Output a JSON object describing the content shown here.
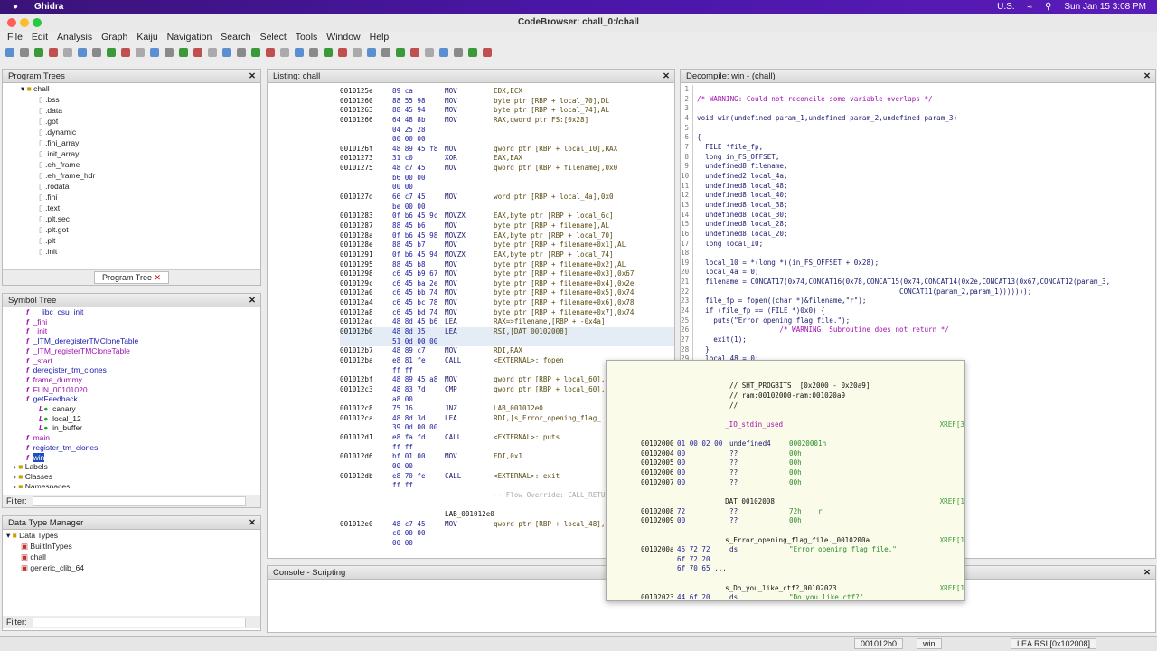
{
  "mac": {
    "app": "Ghidra",
    "keyboard": "U.S.",
    "clock": "Sun Jan 15  3:08 PM"
  },
  "window": {
    "title": "CodeBrowser: chall_0:/chall"
  },
  "menu": [
    "File",
    "Edit",
    "Analysis",
    "Graph",
    "Kaiju",
    "Navigation",
    "Search",
    "Select",
    "Tools",
    "Window",
    "Help"
  ],
  "program_trees": {
    "title": "Program Trees",
    "root": "chall",
    "items": [
      ".bss",
      ".data",
      ".got",
      ".dynamic",
      ".fini_array",
      ".init_array",
      ".eh_frame",
      ".eh_frame_hdr",
      ".rodata",
      ".fini",
      ".text",
      ".plt.sec",
      ".plt.got",
      ".plt",
      ".init"
    ],
    "tab": "Program Tree"
  },
  "symbol_tree": {
    "title": "Symbol Tree",
    "functions": [
      "__libc_csu_init",
      "_fini",
      "_init",
      "_ITM_deregisterTMCloneTable",
      "_ITM_registerTMCloneTable",
      "_start",
      "deregister_tm_clones",
      "frame_dummy",
      "FUN_00101020",
      "getFeedback"
    ],
    "locals": [
      "canary",
      "local_12",
      "in_buffer"
    ],
    "functions2": [
      "main",
      "register_tm_clones",
      "win"
    ],
    "folders": [
      "Labels",
      "Classes",
      "Namespaces"
    ],
    "filter_label": "Filter:"
  },
  "dtm": {
    "title": "Data Type Manager",
    "root": "Data Types",
    "items": [
      "BuiltInTypes",
      "chall",
      "generic_clib_64"
    ],
    "filter_label": "Filter:"
  },
  "listing": {
    "title": "Listing:  chall",
    "rows": [
      [
        "0010125e",
        "89 ca",
        "MOV",
        "EDX,ECX"
      ],
      [
        "00101260",
        "88 55 98",
        "MOV",
        "byte ptr [RBP + local_70],DL"
      ],
      [
        "00101263",
        "88 45 94",
        "MOV",
        "byte ptr [RBP + local_74],AL"
      ],
      [
        "00101266",
        "64 48 8b",
        "MOV",
        "RAX,qword ptr FS:[0x28]"
      ],
      [
        "",
        "04 25 28",
        "",
        ""
      ],
      [
        "",
        "00 00 00",
        "",
        ""
      ],
      [
        "0010126f",
        "48 89 45 f8",
        "MOV",
        "qword ptr [RBP + local_10],RAX"
      ],
      [
        "00101273",
        "31 c0",
        "XOR",
        "EAX,EAX"
      ],
      [
        "00101275",
        "48 c7 45",
        "MOV",
        "qword ptr [RBP + filename],0x0"
      ],
      [
        "",
        "b6 00 00",
        "",
        ""
      ],
      [
        "",
        "00 00",
        "",
        ""
      ],
      [
        "0010127d",
        "66 c7 45",
        "MOV",
        "word ptr [RBP + local_4a],0x0"
      ],
      [
        "",
        "be 00 00",
        "",
        ""
      ],
      [
        "00101283",
        "0f b6 45 9c",
        "MOVZX",
        "EAX,byte ptr [RBP + local_6c]"
      ],
      [
        "00101287",
        "88 45 b6",
        "MOV",
        "byte ptr [RBP + filename],AL"
      ],
      [
        "0010128a",
        "0f b6 45 98",
        "MOVZX",
        "EAX,byte ptr [RBP + local_70]"
      ],
      [
        "0010128e",
        "88 45 b7",
        "MOV",
        "byte ptr [RBP + filename+0x1],AL"
      ],
      [
        "00101291",
        "0f b6 45 94",
        "MOVZX",
        "EAX,byte ptr [RBP + local_74]"
      ],
      [
        "00101295",
        "88 45 b8",
        "MOV",
        "byte ptr [RBP + filename+0x2],AL"
      ],
      [
        "00101298",
        "c6 45 b9 67",
        "MOV",
        "byte ptr [RBP + filename+0x3],0x67"
      ],
      [
        "0010129c",
        "c6 45 ba 2e",
        "MOV",
        "byte ptr [RBP + filename+0x4],0x2e"
      ],
      [
        "001012a0",
        "c6 45 bb 74",
        "MOV",
        "byte ptr [RBP + filename+0x5],0x74"
      ],
      [
        "001012a4",
        "c6 45 bc 78",
        "MOV",
        "byte ptr [RBP + filename+0x6],0x78"
      ],
      [
        "001012a8",
        "c6 45 bd 74",
        "MOV",
        "byte ptr [RBP + filename+0x7],0x74"
      ],
      [
        "001012ac",
        "48 8d 45 b6",
        "LEA",
        "RAX=>filename,[RBP + -0x4a]"
      ],
      [
        "001012b0",
        "48 8d 35",
        "LEA",
        "RSI,[DAT_00102008]"
      ],
      [
        "",
        "51 0d 00 00",
        "",
        ""
      ],
      [
        "001012b7",
        "48 89 c7",
        "MOV",
        "RDI,RAX"
      ],
      [
        "001012ba",
        "e8 81 fe",
        "CALL",
        "<EXTERNAL>::fopen"
      ],
      [
        "",
        "ff ff",
        "",
        ""
      ],
      [
        "001012bf",
        "48 89 45 a8",
        "MOV",
        "qword ptr [RBP + local_60],"
      ],
      [
        "001012c3",
        "48 83 7d",
        "CMP",
        "qword ptr [RBP + local_60],"
      ],
      [
        "",
        "a8 00",
        "",
        ""
      ],
      [
        "001012c8",
        "75 16",
        "JNZ",
        "LAB_001012e0"
      ],
      [
        "001012ca",
        "48 8d 3d",
        "LEA",
        "RDI,[s_Error_opening_flag_"
      ],
      [
        "",
        "39 0d 00 00",
        "",
        ""
      ],
      [
        "001012d1",
        "e8 fa fd",
        "CALL",
        "<EXTERNAL>::puts"
      ],
      [
        "",
        "ff ff",
        "",
        ""
      ],
      [
        "001012d6",
        "bf 01 00",
        "MOV",
        "EDI,0x1"
      ],
      [
        "",
        "00 00",
        "",
        ""
      ],
      [
        "001012db",
        "e8 70 fe",
        "CALL",
        "<EXTERNAL>::exit"
      ],
      [
        "",
        "ff ff",
        "",
        ""
      ],
      [
        "",
        "",
        "",
        "-- Flow Override: CALL_RETURN (CALL_TERMIN"
      ],
      [
        "",
        "",
        "",
        ""
      ],
      [
        "",
        "",
        "LAB_001012e0",
        ""
      ],
      [
        "001012e0",
        "48 c7 45",
        "MOV",
        "qword ptr [RBP + local_48],"
      ],
      [
        "",
        "c0 00 00",
        "",
        ""
      ],
      [
        "",
        "00 00",
        "",
        ""
      ]
    ]
  },
  "decompile": {
    "title": "Decompile: win -  (chall)",
    "lines": [
      "",
      "/* WARNING: Could not reconcile some variable overlaps */",
      "",
      "void win(undefined param_1,undefined param_2,undefined param_3)",
      "",
      "{",
      "  FILE *file_fp;",
      "  long in_FS_OFFSET;",
      "  undefined8 filename;",
      "  undefined2 local_4a;",
      "  undefined8 local_48;",
      "  undefined8 local_40;",
      "  undefined8 local_38;",
      "  undefined8 local_30;",
      "  undefined8 local_28;",
      "  undefined8 local_20;",
      "  long local_10;",
      "",
      "  local_10 = *(long *)(in_FS_OFFSET + 0x28);",
      "  local_4a = 0;",
      "  filename = CONCAT17(0x74,CONCAT16(0x78,CONCAT15(0x74,CONCAT14(0x2e,CONCAT13(0x67,CONCAT12(param_3,",
      "                                                 CONCAT11(param_2,param_1)))))));",
      "  file_fp = fopen((char *)&filename,\"r\");",
      "  if (file_fp == (FILE *)0x0) {",
      "    puts(\"Error opening flag file.\");",
      "                    /* WARNING: Subroutine does not return */",
      "    exit(1);",
      "  }",
      "  local_48 = 0;"
    ]
  },
  "popup": {
    "rows": [
      [
        "",
        "",
        "// SHT_PROGBITS  [0x2000 - 0x20a9]",
        "",
        ""
      ],
      [
        "",
        "",
        "// ram:00102000-ram:001020a9",
        "",
        ""
      ],
      [
        "",
        "",
        "//",
        "",
        ""
      ],
      [
        "",
        "",
        "",
        "",
        ""
      ],
      [
        "",
        "",
        "_IO_stdin_used",
        "",
        "XREF[3"
      ],
      [
        "",
        "",
        "",
        "",
        ""
      ],
      [
        "00102000",
        "01 00 02 00",
        "undefined4",
        "00020001h",
        ""
      ],
      [
        "00102004",
        "00",
        "??",
        "00h",
        ""
      ],
      [
        "00102005",
        "00",
        "??",
        "00h",
        ""
      ],
      [
        "00102006",
        "00",
        "??",
        "00h",
        ""
      ],
      [
        "00102007",
        "00",
        "??",
        "00h",
        ""
      ],
      [
        "",
        "",
        "",
        "",
        ""
      ],
      [
        "",
        "",
        "DAT_00102008",
        "",
        "XREF[1"
      ],
      [
        "00102008",
        "72",
        "??",
        "72h    r",
        ""
      ],
      [
        "00102009",
        "00",
        "??",
        "00h",
        ""
      ],
      [
        "",
        "",
        "",
        "",
        ""
      ],
      [
        "",
        "",
        "s_Error_opening_flag_file._0010200a",
        "",
        "XREF[1"
      ],
      [
        "0010200a",
        "45 72 72",
        "ds",
        "\"Error opening flag file.\"",
        ""
      ],
      [
        "",
        "6f 72 20",
        "",
        "",
        ""
      ],
      [
        "",
        "6f 70 65 ...",
        "",
        "",
        ""
      ],
      [
        "",
        "",
        "",
        "",
        ""
      ],
      [
        "",
        "",
        "s_Do_you_like_ctf?_00102023",
        "",
        "XREF[1"
      ],
      [
        "00102023",
        "44 6f 20",
        "ds",
        "\"Do you like ctf?\"",
        ""
      ],
      [
        "",
        "79 6f 75",
        "",
        "",
        ""
      ]
    ]
  },
  "console": {
    "title": "Console - Scripting"
  },
  "status": {
    "address": "001012b0",
    "function": "win",
    "instruction": "LEA RSI,[0x102008]"
  }
}
